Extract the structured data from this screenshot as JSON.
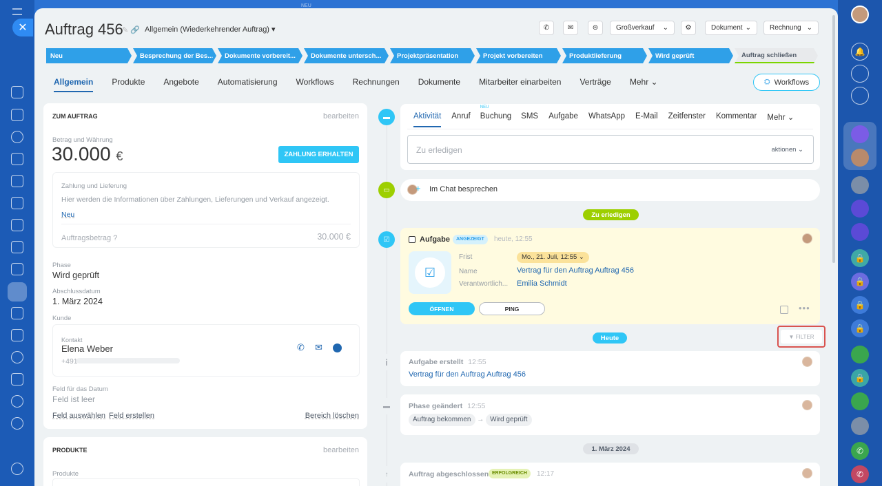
{
  "window": {
    "top_badge": "NEU"
  },
  "header": {
    "title": "Auftrag 456",
    "subtitle": "Allgemein (Wiederkehrender Auftrag)",
    "toolbar": {
      "grossverkauf": "Großverkauf",
      "dokument": "Dokument",
      "rechnung": "Rechnung"
    }
  },
  "stages": [
    {
      "label": "Neu"
    },
    {
      "label": "Besprechung der Bes..."
    },
    {
      "label": "Dokumente vorbereit..."
    },
    {
      "label": "Dokumente untersch..."
    },
    {
      "label": "Projektpräsentation"
    },
    {
      "label": "Projekt vorbereiten"
    },
    {
      "label": "Produktlieferung"
    },
    {
      "label": "Wird geprüft"
    },
    {
      "label": "Auftrag schließen"
    }
  ],
  "tabs": [
    "Allgemein",
    "Produkte",
    "Angebote",
    "Automatisierung",
    "Workflows",
    "Rechnungen",
    "Dokumente",
    "Mitarbeiter einarbeiten",
    "Verträge",
    "Mehr"
  ],
  "workflows_button": "Workflows",
  "left": {
    "section_title": "ZUM AUFTRAG",
    "edit": "bearbeiten",
    "amount_label": "Betrag und Währung",
    "amount": "30.000",
    "currency": "€",
    "payment_button": "ZAHLUNG ERHALTEN",
    "payment_box": {
      "title": "Zahlung und Lieferung",
      "text": "Hier werden die Informationen über Zahlungen, Lieferungen und Verkauf angezeigt.",
      "new_link": "Neu",
      "amount_label": "Auftragsbetrag",
      "amount_value": "30.000 €"
    },
    "phase_label": "Phase",
    "phase_value": "Wird geprüft",
    "date_label": "Abschlussdatum",
    "date_value": "1. März 2024",
    "customer_label": "Kunde",
    "contact": {
      "label": "Kontakt",
      "name": "Elena Weber",
      "phone": "+491"
    },
    "field_label": "Feld für das Datum",
    "field_value": "Feld ist leer",
    "select_field": "Feld auswählen",
    "create_field": "Feld erstellen",
    "delete_section": "Bereich löschen",
    "products_title": "PRODUKTE",
    "products_edit": "bearbeiten",
    "products_label": "Produkte"
  },
  "activity": {
    "tabs": [
      "Aktivität",
      "Anruf",
      "Buchung",
      "SMS",
      "Aufgabe",
      "WhatsApp",
      "E-Mail",
      "Zeitfenster",
      "Kommentar",
      "Mehr"
    ],
    "new_badge": "NEU",
    "todo_placeholder": "Zu erledigen",
    "actions": "aktionen",
    "chat": "Im Chat besprechen",
    "todo_pill": "Zu erledigen",
    "task": {
      "title": "Aufgabe",
      "badge": "ANGEZEIGT",
      "time": "heute, 12:55",
      "frist_label": "Frist",
      "frist_value": "Mo., 21. Juli, 12:55",
      "name_label": "Name",
      "name_value": "Vertrag für den Auftrag Auftrag 456",
      "resp_label": "Verantwortlich...",
      "resp_value": "Emilia Schmidt",
      "open": "ÖFFNEN",
      "ping": "PING"
    },
    "today_pill": "Heute",
    "filter": "FILTER",
    "created": {
      "title": "Aufgabe erstellt",
      "time": "12:55",
      "text": "Vertrag für den Auftrag Auftrag 456"
    },
    "phase_changed": {
      "title": "Phase geändert",
      "time": "12:55",
      "from": "Auftrag bekommen",
      "to": "Wird geprüft"
    },
    "date_pill": "1. März 2024",
    "closed": {
      "title": "Auftrag abgeschlossen",
      "badge": "ERFOLGREICH",
      "time": "12:17"
    }
  },
  "colors": {
    "accent": "#2fc6f6",
    "stage": "#2fa0e8",
    "success": "#9dcf00",
    "link": "#2067b0"
  }
}
